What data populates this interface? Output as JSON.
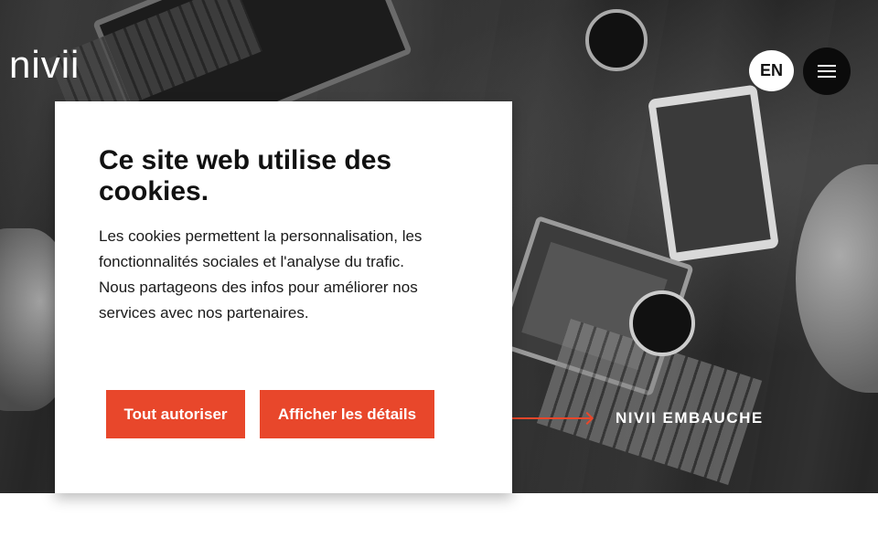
{
  "header": {
    "logo_text": "nivii",
    "language_label": "EN",
    "menu_icon": "hamburger-menu-icon"
  },
  "hero": {
    "careers_link": "NIVII EMBAUCHE",
    "arrow_icon": "arrow-right-icon",
    "accent_color": "#e8472b"
  },
  "cookie_banner": {
    "title": "Ce site web utilise des cookies.",
    "body": "Les cookies permettent la personnalisation, les fonctionnalités sociales et l'analyse du trafic. Nous partageons des infos pour améliorer nos services avec nos partenaires.",
    "allow_all_label": "Tout autoriser",
    "show_details_label": "Afficher les détails",
    "button_color": "#e8472b"
  }
}
